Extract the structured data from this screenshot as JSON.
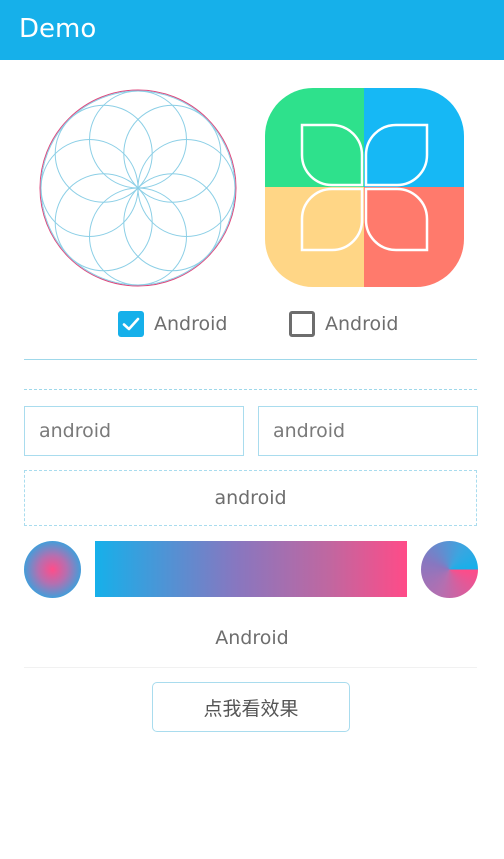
{
  "appbar": {
    "title": "Demo",
    "color": "#16b0ea"
  },
  "checkboxes": [
    {
      "label": "Android",
      "checked": true
    },
    {
      "label": "Android",
      "checked": false
    }
  ],
  "inputs": {
    "left_value": "android",
    "right_value": "android"
  },
  "dashed_box_text": "android",
  "center_text": "Android",
  "action_button_label": "点我看效果",
  "colors": {
    "accent": "#16b0ea",
    "pink": "#ff4b88",
    "tile_green": "#2ee18c",
    "tile_blue": "#16b8f5",
    "tile_yellow": "#ffd686",
    "tile_red": "#ff7a6c",
    "rosette_stroke": "#8ccfe6",
    "rosette_outline": "#e0457a"
  }
}
